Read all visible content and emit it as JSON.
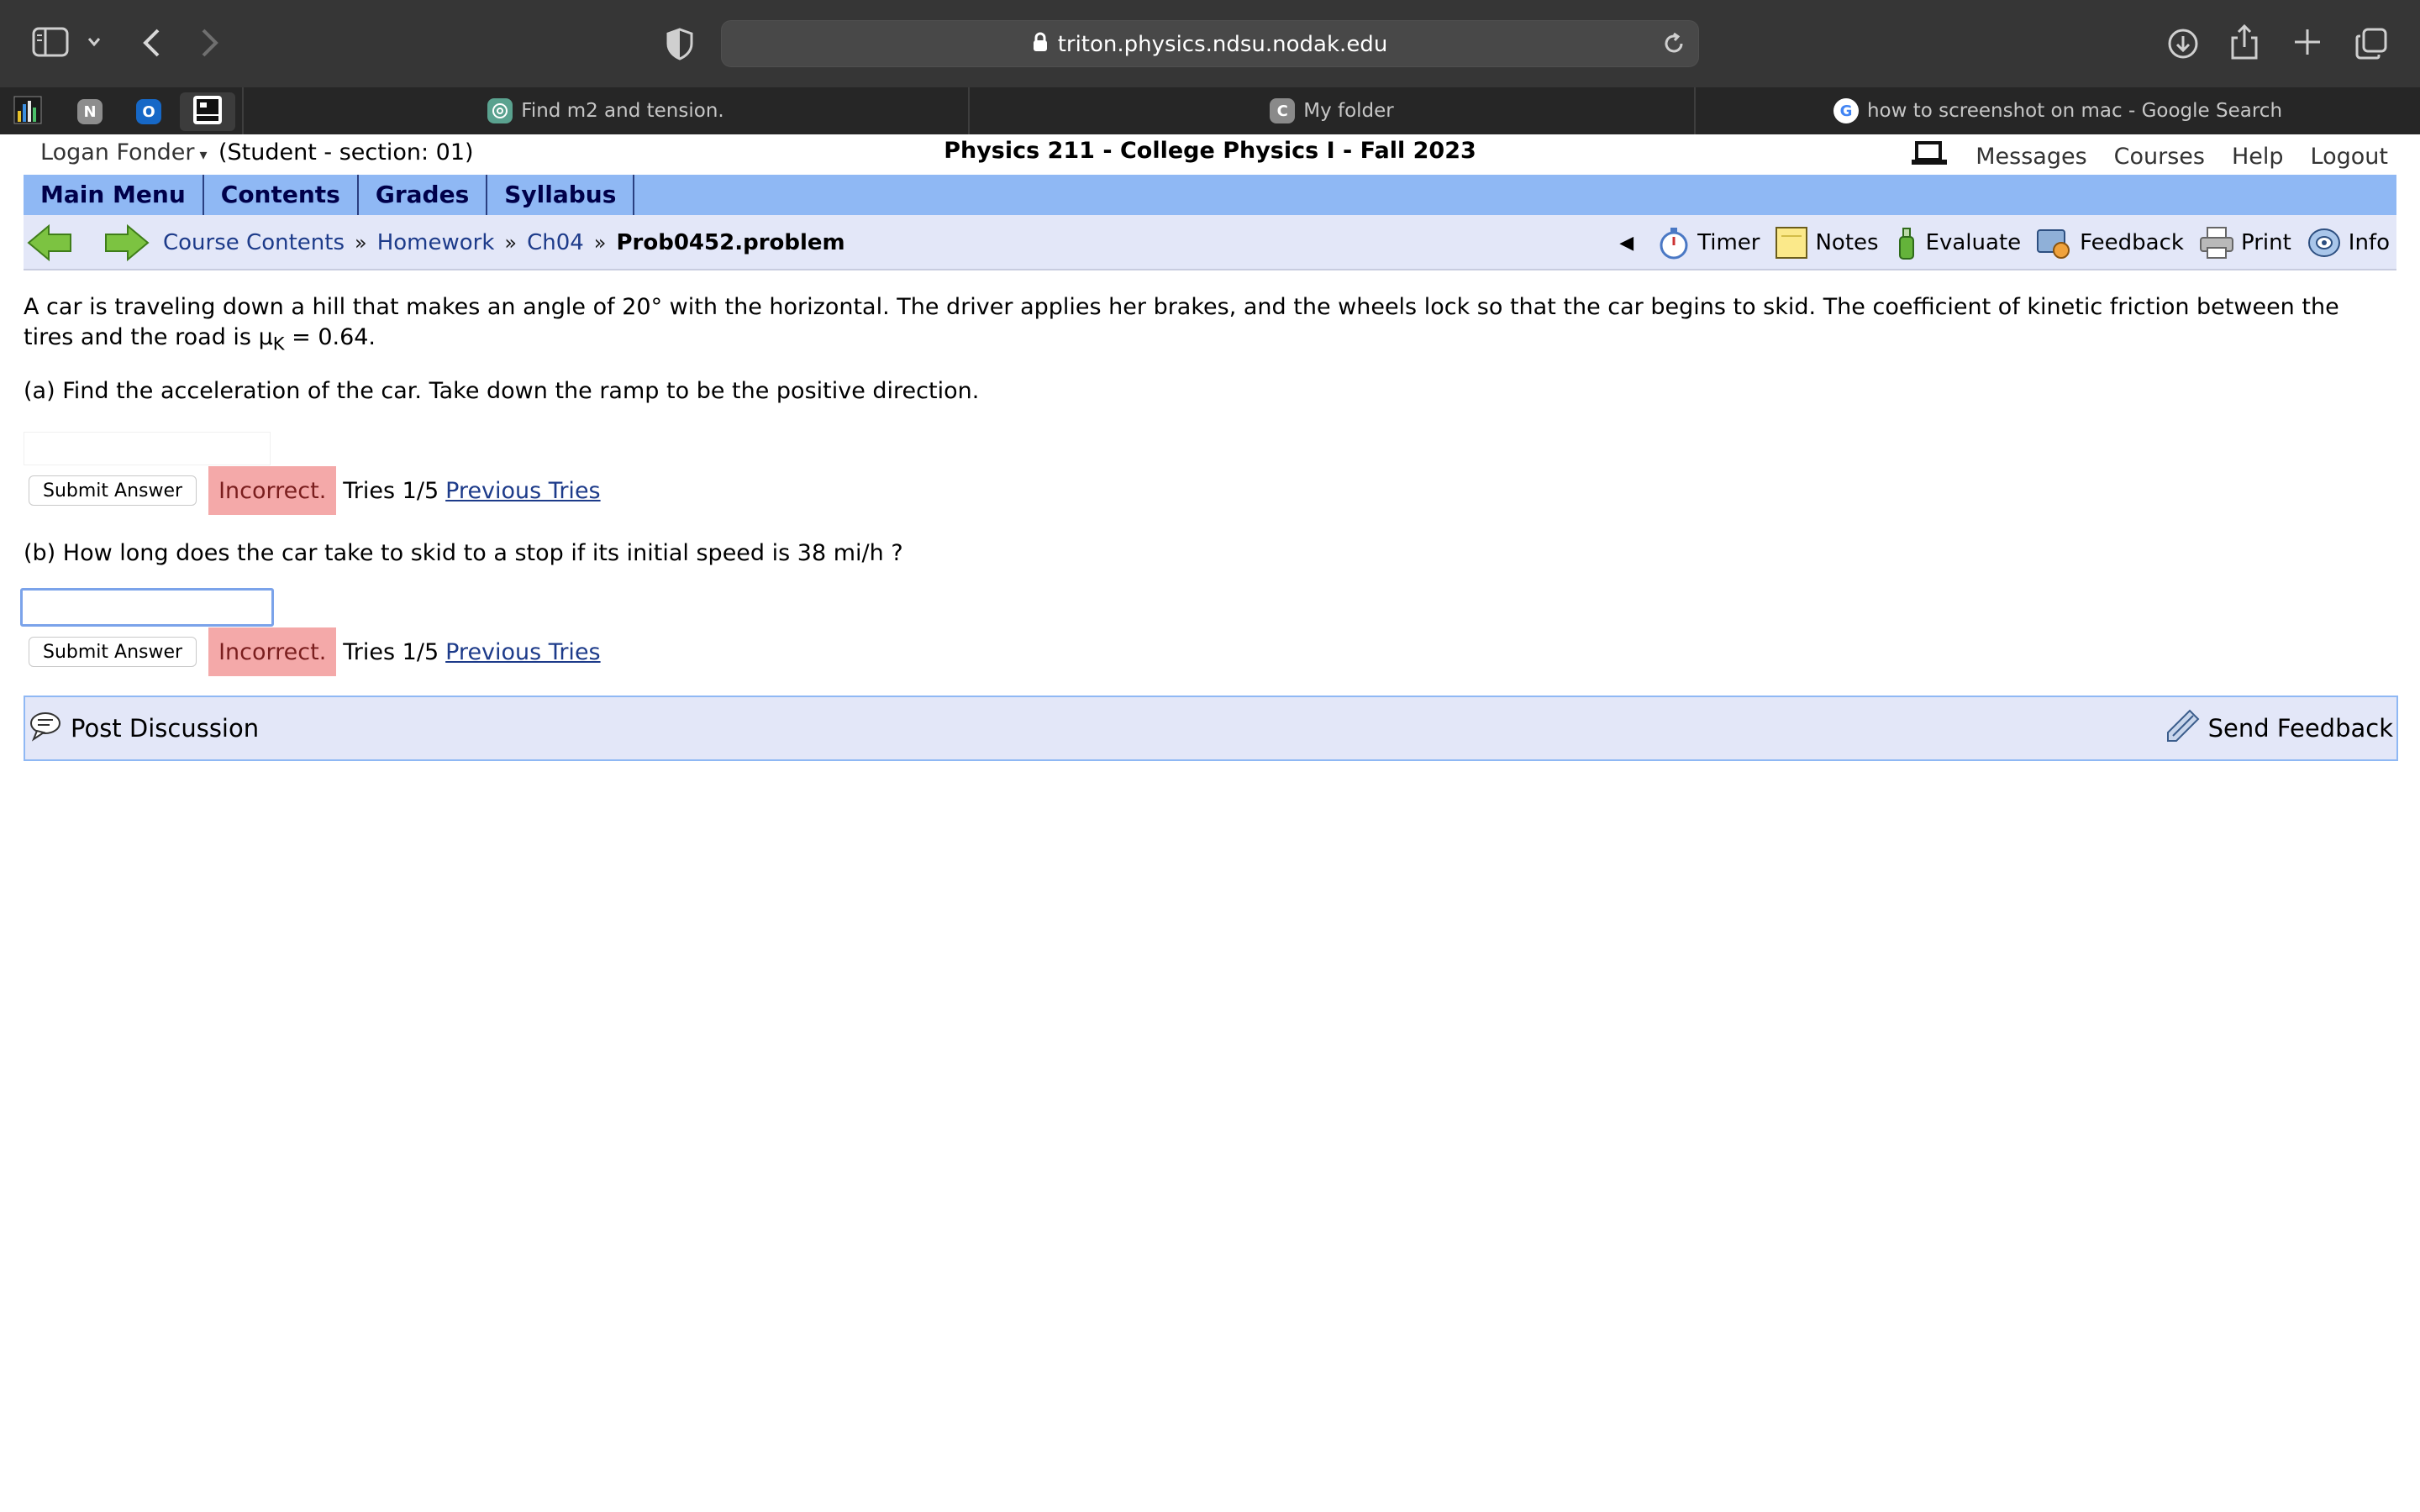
{
  "browser": {
    "url": "triton.physics.ndsu.nodak.edu",
    "pinned_tabs": [
      {
        "icon": "bar-chart-icon"
      },
      {
        "icon": "notion-icon",
        "label": "N"
      },
      {
        "icon": "outlook-icon",
        "label": "O"
      },
      {
        "icon": "lon-capa-icon"
      }
    ],
    "tabs": [
      {
        "title": "Find m2 and tension.",
        "icon": "chatgpt-icon"
      },
      {
        "title": "My folder",
        "icon": "chegg-icon",
        "icon_label": "C"
      },
      {
        "title": "how to screenshot on mac - Google Search",
        "icon": "google-icon",
        "icon_label": "G"
      }
    ]
  },
  "userbar": {
    "user_name": "Logan Fonder",
    "caret": "▾",
    "role": "(Student  - section: 01)",
    "course_title": "Physics 211 - College Physics I - Fall 2023",
    "links": [
      "Messages",
      "Courses",
      "Help",
      "Logout"
    ]
  },
  "main_menu": [
    "Main Menu",
    "Contents",
    "Grades",
    "Syllabus"
  ],
  "breadcrumb": {
    "items": [
      "Course Contents",
      "Homework",
      "Ch04"
    ],
    "separator": "»",
    "current": "Prob0452.problem"
  },
  "tools": {
    "collapse": "◀",
    "items": [
      "Timer",
      "Notes",
      "Evaluate",
      "Feedback",
      "Print",
      "Info"
    ]
  },
  "problem": {
    "statement_main": "A car is traveling down a hill that makes an angle of 20° with the horizontal. The driver applies her brakes, and the wheels lock so that the car begins to skid. The coefficient of kinetic friction between the tires and the road is μ",
    "statement_sub": "K",
    "statement_end": " = 0.64.",
    "part_a": {
      "question": "(a) Find the acceleration of the car. Take down the ramp to be the positive direction.",
      "answer": "",
      "submit_label": "Submit Answer",
      "status": "Incorrect.",
      "tries": "Tries 1/5",
      "previous_tries": "Previous Tries"
    },
    "part_b": {
      "question": "(b) How long does the car take to skid to a stop if its initial speed is 38 mi/h ?",
      "answer": "",
      "submit_label": "Submit Answer",
      "status": "Incorrect.",
      "tries": "Tries 1/5",
      "previous_tries": "Previous Tries"
    }
  },
  "footer": {
    "post_discussion": "Post Discussion",
    "send_feedback": "Send Feedback"
  }
}
